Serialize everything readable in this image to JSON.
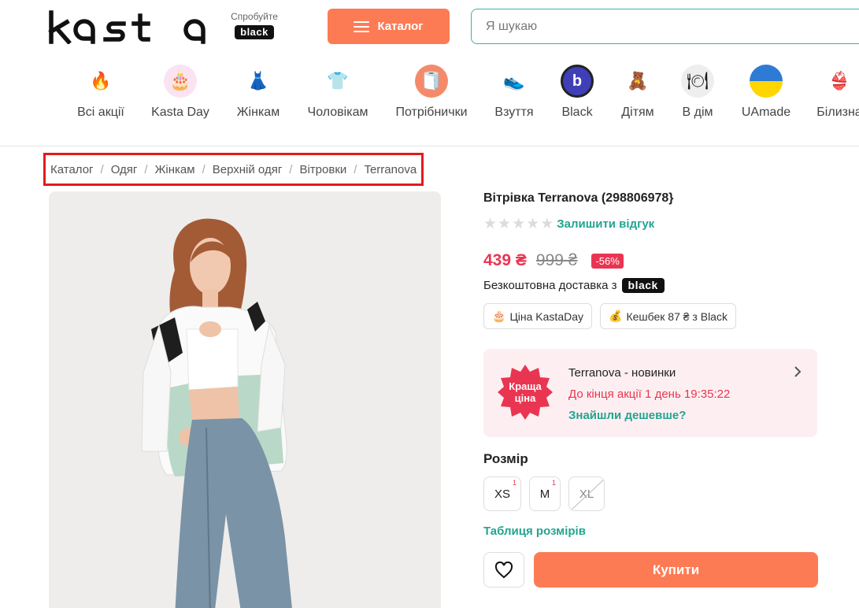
{
  "header": {
    "logo_text": "kasta",
    "try_text": "Спробуйте",
    "black_label": "black",
    "catalog_label": "Каталог",
    "search_placeholder": "Я шукаю"
  },
  "categories": [
    {
      "label": "Всі акції",
      "icon": "fire-icon",
      "glyph": "🔥",
      "bg": "#ffffff"
    },
    {
      "label": "Kasta Day",
      "icon": "cake-icon",
      "glyph": "🎂",
      "bg": "#fbe3f2"
    },
    {
      "label": "Жінкам",
      "icon": "dress-icon",
      "glyph": "👗",
      "bg": "#ffffff"
    },
    {
      "label": "Чоловікам",
      "icon": "shirt-icon",
      "glyph": "👕",
      "bg": "#ffffff"
    },
    {
      "label": "Потрібнички",
      "icon": "paper-roll-icon",
      "glyph": "🧻",
      "bg": "#f58a6a"
    },
    {
      "label": "Взуття",
      "icon": "sneaker-icon",
      "glyph": "👟",
      "bg": "#ffffff"
    },
    {
      "label": "Black",
      "icon": "black-b-icon",
      "glyph": "b",
      "bg": "#3f3fb8"
    },
    {
      "label": "Дітям",
      "icon": "kid-icon",
      "glyph": "🧸",
      "bg": "#ffffff"
    },
    {
      "label": "В дім",
      "icon": "plate-icon",
      "glyph": "🍽",
      "bg": "#eeeeee"
    },
    {
      "label": "UAmade",
      "icon": "ukraine-flag-icon",
      "glyph": "",
      "bg": "#ffd500"
    },
    {
      "label": "Білизна",
      "icon": "lingerie-icon",
      "glyph": "👙",
      "bg": "#ffffff"
    }
  ],
  "breadcrumb": [
    "Каталог",
    "Одяг",
    "Жінкам",
    "Верхній одяг",
    "Вітровки",
    "Terranova"
  ],
  "product": {
    "title": "Вітрівка Terranova (298806978}",
    "review_link": "Залишити відгук",
    "rating_stars": 0,
    "price_now": "439 ₴",
    "price_old": "999 ₴",
    "discount": "-56%",
    "delivery_text": "Безкоштовна доставка з",
    "delivery_badge": "black",
    "tags": [
      {
        "icon": "cake-icon",
        "glyph": "🎂",
        "label": "Ціна KastaDay"
      },
      {
        "icon": "money-bag-icon",
        "glyph": "💰",
        "label": "Кешбек 87 ₴ з Black"
      }
    ]
  },
  "promo": {
    "badge_line1": "Краща",
    "badge_line2": "ціна",
    "title": "Terranova - новинки",
    "timer": "До кінця акції 1 день 19:35:22",
    "cheaper_link": "Знайшли дешевше?"
  },
  "sizes": {
    "title": "Розмір",
    "items": [
      {
        "label": "XS",
        "count": "1",
        "available": true
      },
      {
        "label": "M",
        "count": "1",
        "available": true
      },
      {
        "label": "XL",
        "count": "",
        "available": false
      }
    ],
    "table_link": "Таблиця розмірів"
  },
  "buy_label": "Купити",
  "colors": {
    "accent": "#fd7b54",
    "teal": "#22a491",
    "price_red": "#ea3552"
  }
}
